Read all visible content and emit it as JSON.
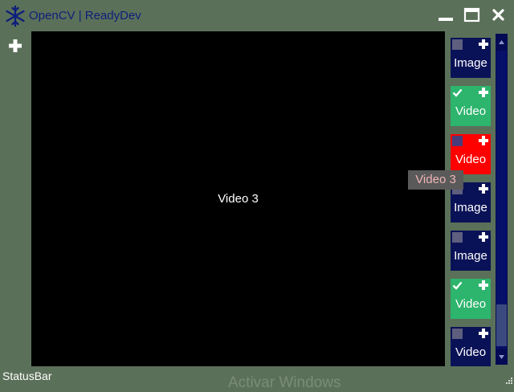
{
  "window": {
    "title": "OpenCV | ReadyDev",
    "app_icon": "snowflake-icon",
    "controls": [
      "minimize-icon",
      "maximize-icon",
      "close-icon"
    ]
  },
  "toolbar": {
    "add_icon": "plus-icon"
  },
  "main": {
    "video_label": "Video 3"
  },
  "thumbnails": [
    {
      "label": "Image",
      "checked": false,
      "color": "#0a1257"
    },
    {
      "label": "Video",
      "checked": true,
      "color": "#2db46d"
    },
    {
      "label": "Video",
      "checked": false,
      "color": "#ff0000"
    },
    {
      "label": "Image",
      "checked": false,
      "color": "#0a1257"
    },
    {
      "label": "Image",
      "checked": false,
      "color": "#0a1257"
    },
    {
      "label": "Video",
      "checked": true,
      "color": "#2db46d"
    },
    {
      "label": "Video",
      "checked": false,
      "color": "#0a1257"
    }
  ],
  "tooltip": {
    "text": "Video 3"
  },
  "statusbar": {
    "text": "StatusBar"
  },
  "watermark": {
    "text": "Activar Windows"
  },
  "colors": {
    "background": "#5b7059",
    "title_text": "#0d1f7a",
    "video_bg": "#000000",
    "scrollbar": "#050a55"
  }
}
